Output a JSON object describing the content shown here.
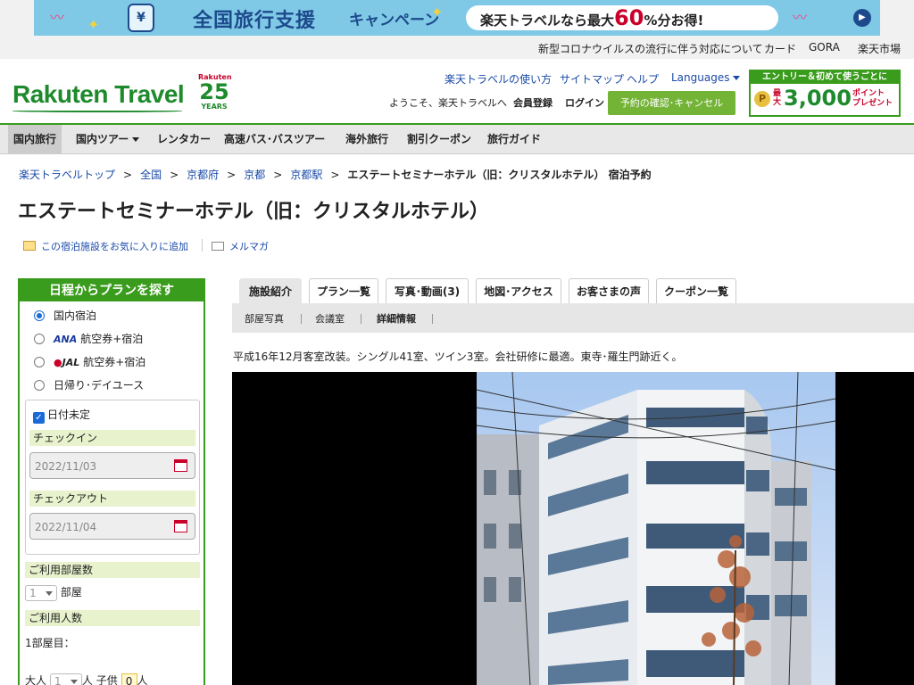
{
  "banner": {
    "title": "全国旅行支援",
    "subtitle": "キャンペーン",
    "pill_prefix": "楽天トラベルなら最大",
    "pill_num": "60",
    "pill_suffix": "%分お得!"
  },
  "utility": {
    "links": [
      "新型コロナウイルスの流行に伴う対応について",
      "カード",
      "GORA",
      "楽天市場"
    ]
  },
  "header": {
    "logo": "Rakuten Travel",
    "anniv_top": "Rakuten",
    "anniv_num": "25",
    "anniv_years": "YEARS",
    "nav": [
      "楽天トラベルの使い方",
      "サイトマップ",
      "ヘルプ",
      "Languages"
    ],
    "welcome": "ようこそ、楽天トラベルへ",
    "register": "会員登録",
    "login": "ログイン",
    "reserve_button": "予約の確認･キャンセル",
    "promo_top": "エントリー＆初めて使うごとに",
    "promo_small": "最大",
    "promo_num": "3,000",
    "promo_unit1": "ポイント",
    "promo_unit2": "プレゼント"
  },
  "mainnav": [
    "国内旅行",
    "国内ツアー",
    "レンタカー",
    "高速バス･バスツアー",
    "海外旅行",
    "割引クーポン",
    "旅行ガイド"
  ],
  "breadcrumb": {
    "items": [
      "楽天トラベルトップ",
      "全国",
      "京都府",
      "京都",
      "京都駅"
    ],
    "current": "エステートセミナーホテル（旧：クリスタルホテル） 宿泊予約"
  },
  "page_title": "エステートセミナーホテル（旧：クリスタルホテル）",
  "actions": {
    "favorite": "この宿泊施設をお気に入りに追加",
    "mailmag": "メルマガ"
  },
  "search": {
    "heading": "日程からプランを探す",
    "options": [
      "国内宿泊",
      "航空券+宿泊",
      "航空券+宿泊",
      "日帰り･デイユース"
    ],
    "ana": "ANA",
    "jal": "JAL",
    "undecided": "日付未定",
    "checkin_label": "チェックイン",
    "checkin_value": "2022/11/03",
    "checkout_label": "チェックアウト",
    "checkout_value": "2022/11/04",
    "rooms_label": "ご利用部屋数",
    "rooms_value": "1",
    "rooms_unit": "部屋",
    "guests_label": "ご利用人数",
    "room1": "1部屋目：",
    "adult_label": "大人",
    "adult_value": "1",
    "person_unit": "人",
    "child_label": "子供",
    "child_value": "0"
  },
  "tabs": [
    "施設紹介",
    "プラン一覧",
    "写真･動画(3)",
    "地図･アクセス",
    "お客さまの声",
    "クーポン一覧"
  ],
  "subtabs": [
    "部屋写真",
    "会議室",
    "詳細情報"
  ],
  "description": "平成16年12月客室改装。シングル41室、ツイン3室。会社研修に最適。東寺･羅生門跡近く。"
}
